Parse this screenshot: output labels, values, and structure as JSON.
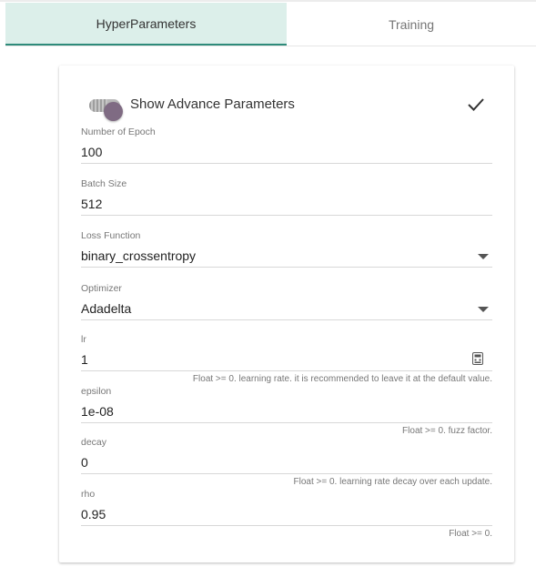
{
  "tabs": [
    {
      "label": "HyperParameters",
      "active": true
    },
    {
      "label": "Training",
      "active": false
    }
  ],
  "advanced": {
    "label": "Show Advance Parameters",
    "enabled": true,
    "confirm_icon": "check-icon"
  },
  "fields": {
    "epochs": {
      "label": "Number of Epoch",
      "value": "100"
    },
    "batch_size": {
      "label": "Batch Size",
      "value": "512"
    },
    "loss": {
      "label": "Loss Function",
      "value": "binary_crossentropy"
    },
    "optimizer": {
      "label": "Optimizer",
      "value": "Adadelta"
    },
    "lr": {
      "label": "lr",
      "value": "1",
      "helper": "Float >= 0. learning rate. it is recommended to leave it at the default value."
    },
    "epsilon": {
      "label": "epsilon",
      "value": "1e-08",
      "helper": "Float >= 0. fuzz factor."
    },
    "decay": {
      "label": "decay",
      "value": "0",
      "helper": "Float >= 0. learning rate decay over each update."
    },
    "rho": {
      "label": "rho",
      "value": "0.95",
      "helper": "Float >= 0."
    }
  },
  "colors": {
    "active_tab_bg": "#dcefea",
    "active_tab_indicator": "#2e8b7a",
    "toggle_thumb": "#7f6b83"
  }
}
